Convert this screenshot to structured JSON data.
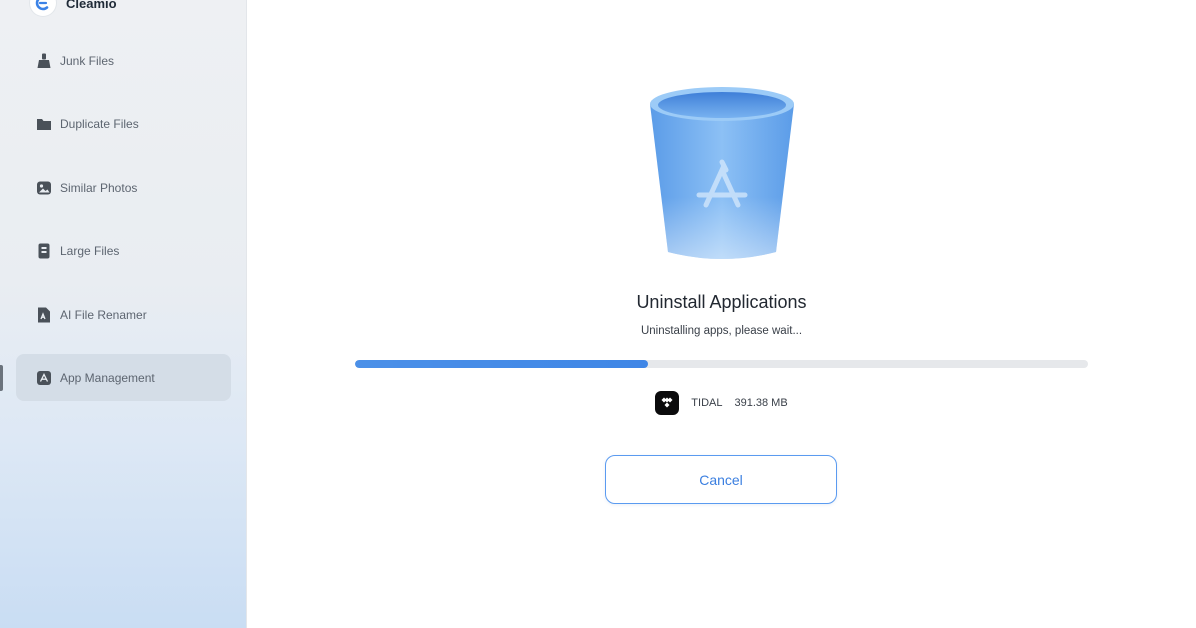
{
  "brand": {
    "name": "Cleamio",
    "logo_icon": "cleamio-logo-icon"
  },
  "sidebar": {
    "items": [
      {
        "label": "Junk Files",
        "icon": "broom-icon",
        "active": false
      },
      {
        "label": "Duplicate Files",
        "icon": "folder-icon",
        "active": false
      },
      {
        "label": "Similar Photos",
        "icon": "photo-icon",
        "active": false
      },
      {
        "label": "Large Files",
        "icon": "large-file-icon",
        "active": false
      },
      {
        "label": "AI File Renamer",
        "icon": "ai-rename-icon",
        "active": false
      },
      {
        "label": "App Management",
        "icon": "app-management-icon",
        "active": true
      }
    ]
  },
  "main": {
    "title": "Uninstall Applications",
    "subtitle": "Uninstalling apps, please wait...",
    "progress": 0.4,
    "current_app": {
      "name": "TIDAL",
      "size": "391.38  MB",
      "icon": "tidal-icon"
    },
    "cancel_label": "Cancel"
  },
  "colors": {
    "accent": "#3f86e6",
    "sidebar_active": "#d4dde7",
    "bin_blue": "#6aa8ee"
  }
}
